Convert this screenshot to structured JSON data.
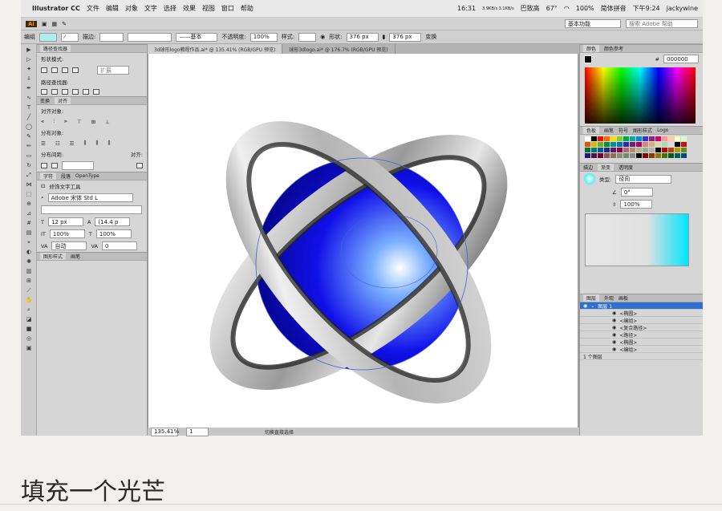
{
  "menubar": {
    "apple": "",
    "app": "Illustrator CC",
    "items": [
      "文件",
      "编辑",
      "对象",
      "文字",
      "选择",
      "效果",
      "视图",
      "窗口",
      "帮助"
    ],
    "clock": "16:31",
    "net": "3.9KB/s 3.1KB/s",
    "cpu": "巴致高",
    "temp": "67°",
    "battery": "100%",
    "input": "简体拼音",
    "time": "下午9:24",
    "user": "jackywine"
  },
  "toolbar": {
    "logo": "Ai",
    "workspace": "基本功能",
    "search_placeholder": "搜索 Adobe 帮助"
  },
  "control_bar": {
    "group": "编组",
    "stroke_label": "描边:",
    "stroke_style": "基本",
    "opacity_label": "不透明度:",
    "opacity": "100%",
    "style_label": "样式:",
    "shape_label": "形状:",
    "width": "376 px",
    "height": "376 px",
    "transform": "变换"
  },
  "left_panels": {
    "pathfinder_title": "路径查找器",
    "shape_modes": "形状模式:",
    "expand": "扩展",
    "pathfinders": "路径查找器:",
    "align_tabs": [
      "变换",
      "对齐"
    ],
    "align_objects": "对齐对象:",
    "distribute_objects": "分布对象:",
    "distribute_spacing": "分布间距:",
    "align_to": "对齐:",
    "char_tabs": [
      "字符",
      "段落",
      "OpenType"
    ],
    "touch_type": "修饰文字工具",
    "font": "Adobe 宋体 Std L",
    "font_size": "12 px",
    "leading": "(14.4 p",
    "vscale": "100%",
    "hscale": "100%",
    "kerning": "自动",
    "tracking": "0",
    "bottom_tabs": [
      "图形样式",
      "画笔"
    ]
  },
  "document": {
    "tabs": [
      "3d球形logo教程作品.ai* @ 135.41% (RGB/GPU 预览)",
      "球形3dlogo.ai* @ 176.7% (RGB/GPU 预览)"
    ],
    "zoom": "135.41%",
    "page": "1",
    "status": "切换直接选择"
  },
  "right_panels": {
    "color_tabs": [
      "颜色",
      "颜色参考"
    ],
    "hex": "000000",
    "swatch_tabs": [
      "色板",
      "画笔",
      "符号",
      "图形样式",
      "Logo"
    ],
    "grad_tabs": [
      "描边",
      "渐变",
      "透明度"
    ],
    "grad_type_label": "类型:",
    "grad_type": "径向",
    "angle": "0°",
    "aspect": "100%",
    "layer_tabs": [
      "图层",
      "外观",
      "画板"
    ],
    "layer_name": "图层 1",
    "layers": [
      "<椭圆>",
      "<编组>",
      "<复合路径>",
      "<路径>",
      "<椭圆>",
      "<编组>"
    ],
    "layer_count": "1 个图层"
  },
  "caption": "填充一个光芒"
}
